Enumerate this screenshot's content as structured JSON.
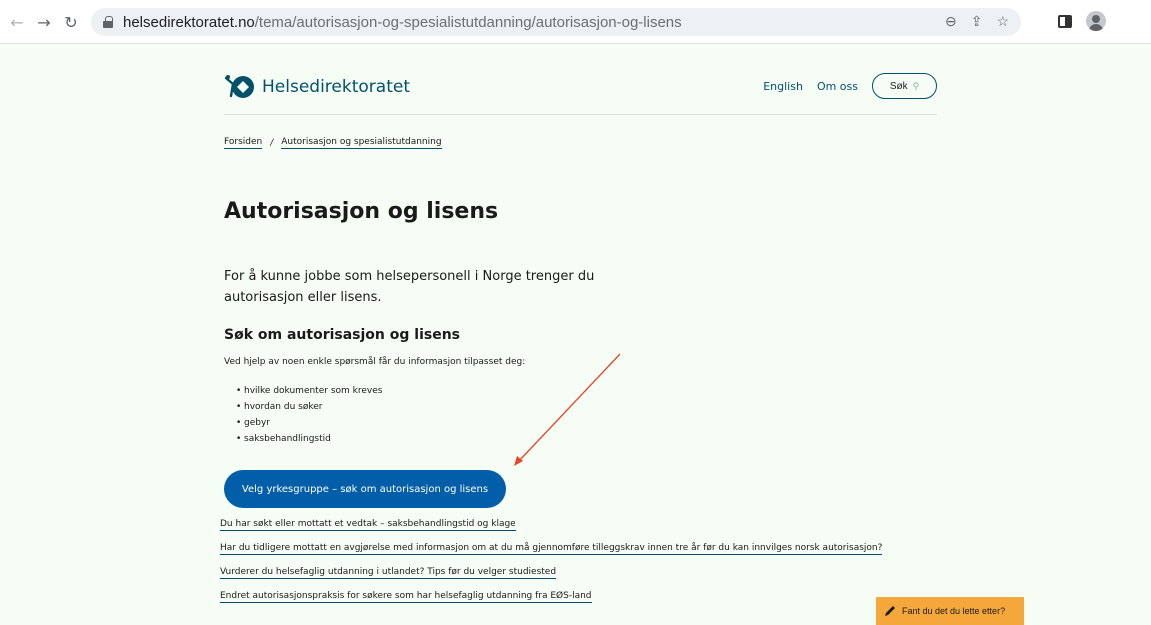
{
  "browser": {
    "url_domain": "helsedirektoratet.no",
    "url_path": "/tema/autorisasjon-og-spesialistutdanning/autorisasjon-og-lisens"
  },
  "header": {
    "logo_text": "Helsedirektoratet",
    "links": {
      "english": "English",
      "about": "Om oss"
    },
    "search_label": "Søk"
  },
  "breadcrumb": {
    "home": "Forsiden",
    "separator": "/",
    "current": "Autorisasjon og spesialistutdanning"
  },
  "main": {
    "title": "Autorisasjon og lisens",
    "lead": "For å kunne jobbe som helsepersonell i Norge trenger du autorisasjon eller lisens.",
    "section_title": "Søk om autorisasjon og lisens",
    "intro": "Ved hjelp av noen enkle spørsmål får du informasjon tilpasset deg:",
    "bullets": [
      "hvilke dokumenter som kreves",
      "hvordan du søker",
      "gebyr",
      "saksbehandlingstid"
    ],
    "cta_label": "Velg yrkesgruppe – søk om autorisasjon og lisens",
    "links": [
      "Du har søkt eller mottatt et vedtak – saksbehandlingstid og klage",
      "Har du tidligere mottatt en avgjørelse med informasjon om at du må gjennomføre tilleggskrav innen tre år før du kan innvilges norsk autorisasjon?",
      "Vurderer du helsefaglig utdanning i utlandet? Tips før du velger studiested",
      "Endret autorisasjonspraksis for søkere som har helsefaglig utdanning fra EØS-land"
    ]
  },
  "feedback": {
    "label": "Fant du det du lette etter?"
  },
  "colors": {
    "background": "#f5fdf4",
    "brand": "#025169",
    "button": "#025ea8",
    "feedback": "#f4a73a",
    "annotation_arrow": "#e8432b"
  }
}
